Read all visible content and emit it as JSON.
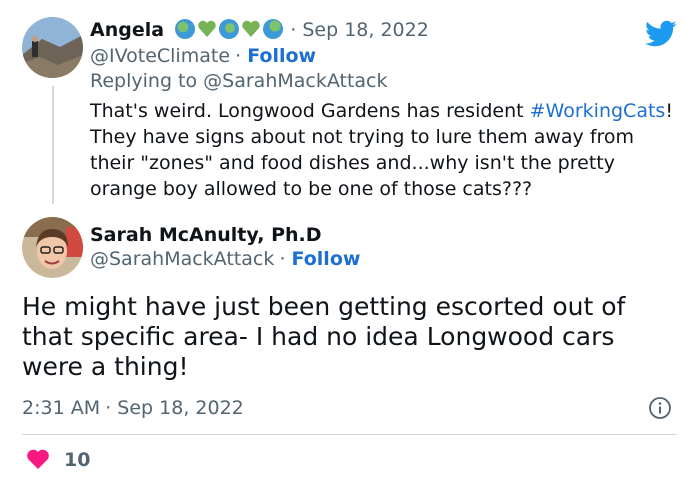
{
  "tweet1": {
    "name": "Angela",
    "name_emojis": [
      "globe-americas",
      "green-heart",
      "globe-africa",
      "green-heart",
      "globe-asia"
    ],
    "date": "Sep 18, 2022",
    "handle": "@IVoteClimate",
    "follow": "Follow",
    "replying_prefix": "Replying to ",
    "replying_to": "@SarahMackAttack",
    "text_lines": [
      {
        "before": "That's weird. Longwood Gardens has resident ",
        "hashtag": "#WorkingCats",
        "after": "!"
      },
      {
        "before": "They have signs about not trying to lure them away from",
        "hashtag": "",
        "after": ""
      },
      {
        "before": "their \"zones\" and food dishes and...why isn't the pretty",
        "hashtag": "",
        "after": ""
      },
      {
        "before": "orange boy allowed to be one of those cats???",
        "hashtag": "",
        "after": ""
      }
    ]
  },
  "tweet2": {
    "name": "Sarah McAnulty, Ph.D",
    "handle": "@SarahMackAttack",
    "follow": "Follow",
    "text_lines": [
      "He might have just been getting escorted out of",
      "that specific area- I had no idea Longwood cars",
      "were a thing!"
    ],
    "time": "2:31 AM",
    "date": "Sep 18, 2022",
    "likes": "10"
  },
  "colors": {
    "link": "#1d6fd1",
    "muted": "#536471",
    "like": "#f91880",
    "twitter": "#1d9bf0"
  }
}
